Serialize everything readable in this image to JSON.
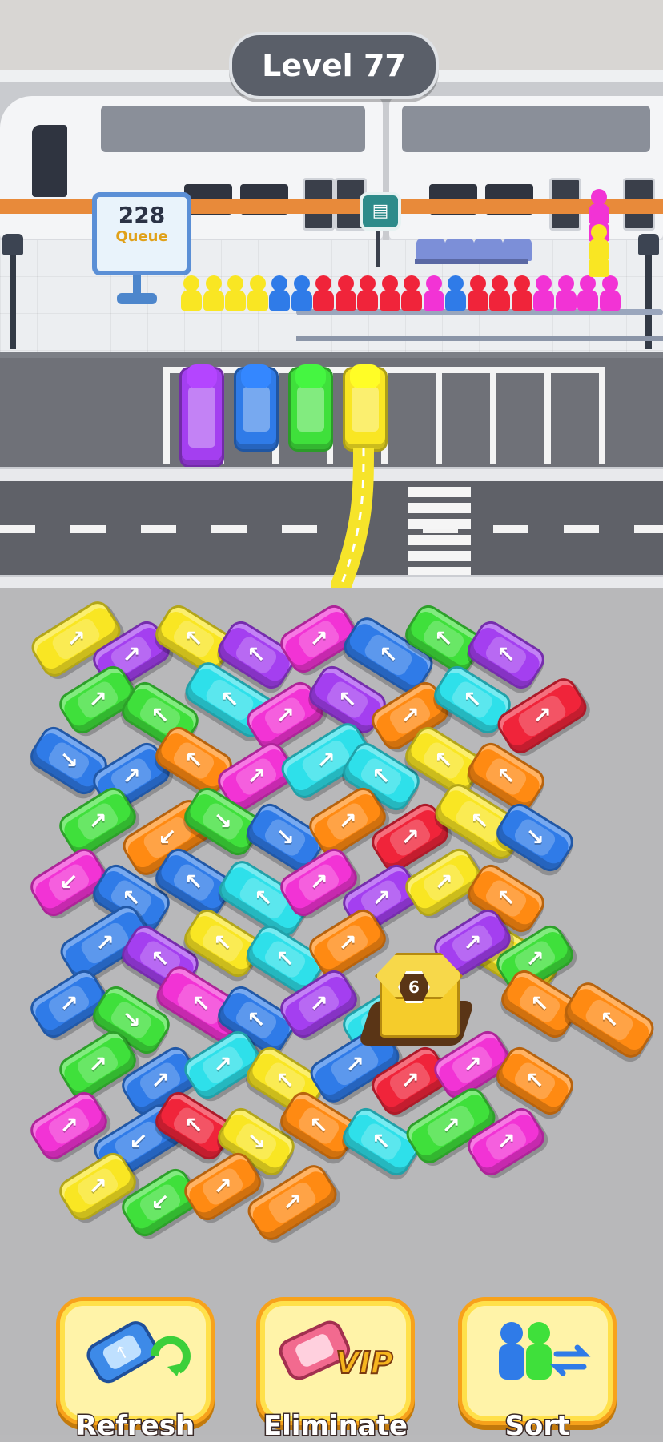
{
  "header": {
    "level_label": "Level 77"
  },
  "queue_board": {
    "count": "228",
    "label": "Queue"
  },
  "station_sign_icon": "bus-stop-icon",
  "colors": {
    "yellow": "#f9e623",
    "blue": "#2f7be8",
    "green": "#3fe03b",
    "purple": "#a43ff0",
    "red": "#f0243a",
    "magenta": "#f233d5",
    "cyan": "#2ee0ea",
    "orange": "#ff8a12",
    "button_border": "#f7a21b"
  },
  "queue_people": [
    "yellow",
    "yellow",
    "yellow",
    "yellow",
    "blue",
    "blue",
    "red",
    "red",
    "red",
    "red",
    "red",
    "magenta",
    "blue",
    "red",
    "red",
    "red",
    "magenta",
    "magenta",
    "magenta",
    "magenta",
    "magenta",
    "magenta",
    "yellow",
    "yellow"
  ],
  "parked_cars": [
    "purple",
    "blue",
    "green",
    "yellow"
  ],
  "parking_slots_total": 8,
  "shop": {
    "count": "6"
  },
  "buttons": {
    "refresh": {
      "label": "Refresh",
      "icon": "refresh-car-icon"
    },
    "eliminate": {
      "label": "Eliminate",
      "icon": "vip-car-icon",
      "badge": "VIP"
    },
    "sort": {
      "label": "Sort",
      "icon": "sort-people-icon"
    }
  },
  "lot_cars": [
    {
      "c": "yellow",
      "dir": "up-right"
    },
    {
      "c": "purple",
      "dir": "up-right"
    },
    {
      "c": "yellow",
      "dir": "up-left"
    },
    {
      "c": "purple",
      "dir": "up-left"
    },
    {
      "c": "magenta",
      "dir": "up-right"
    },
    {
      "c": "blue",
      "dir": "up-left"
    },
    {
      "c": "green",
      "dir": "up-left"
    },
    {
      "c": "purple",
      "dir": "up-left"
    },
    {
      "c": "green",
      "dir": "up-right"
    },
    {
      "c": "green",
      "dir": "up-left"
    },
    {
      "c": "cyan",
      "dir": "up-left"
    },
    {
      "c": "magenta",
      "dir": "up-right"
    },
    {
      "c": "purple",
      "dir": "up-left"
    },
    {
      "c": "orange",
      "dir": "up-right"
    },
    {
      "c": "cyan",
      "dir": "up-left"
    },
    {
      "c": "red",
      "dir": "up-right"
    },
    {
      "c": "blue",
      "dir": "down-right"
    },
    {
      "c": "blue",
      "dir": "up-right"
    },
    {
      "c": "orange",
      "dir": "up-left"
    },
    {
      "c": "magenta",
      "dir": "up-right"
    },
    {
      "c": "cyan",
      "dir": "up-right"
    },
    {
      "c": "cyan",
      "dir": "up-left"
    },
    {
      "c": "yellow",
      "dir": "up-left"
    },
    {
      "c": "orange",
      "dir": "up-left"
    },
    {
      "c": "green",
      "dir": "up-right"
    },
    {
      "c": "orange",
      "dir": "down-left"
    },
    {
      "c": "green",
      "dir": "down-right"
    },
    {
      "c": "blue",
      "dir": "down-right"
    },
    {
      "c": "orange",
      "dir": "up-right"
    },
    {
      "c": "red",
      "dir": "up-right"
    },
    {
      "c": "yellow",
      "dir": "up-left"
    },
    {
      "c": "blue",
      "dir": "down-right"
    },
    {
      "c": "magenta",
      "dir": "down-left"
    },
    {
      "c": "blue",
      "dir": "up-left"
    },
    {
      "c": "blue",
      "dir": "up-left"
    },
    {
      "c": "cyan",
      "dir": "up-left"
    },
    {
      "c": "magenta",
      "dir": "up-right"
    },
    {
      "c": "purple",
      "dir": "up-right"
    },
    {
      "c": "yellow",
      "dir": "up-right"
    },
    {
      "c": "orange",
      "dir": "up-left"
    },
    {
      "c": "blue",
      "dir": "up-right"
    },
    {
      "c": "purple",
      "dir": "up-left"
    },
    {
      "c": "yellow",
      "dir": "up-left"
    },
    {
      "c": "cyan",
      "dir": "up-left"
    },
    {
      "c": "orange",
      "dir": "up-right"
    },
    {
      "c": "yellow",
      "dir": "down-right"
    },
    {
      "c": "purple",
      "dir": "up-right"
    },
    {
      "c": "green",
      "dir": "up-right"
    },
    {
      "c": "blue",
      "dir": "up-right"
    },
    {
      "c": "green",
      "dir": "down-right"
    },
    {
      "c": "magenta",
      "dir": "up-left"
    },
    {
      "c": "blue",
      "dir": "up-left"
    },
    {
      "c": "purple",
      "dir": "up-right"
    },
    {
      "c": "cyan",
      "dir": "up-right"
    },
    {
      "c": "orange",
      "dir": "up-left"
    },
    {
      "c": "orange",
      "dir": "up-left"
    },
    {
      "c": "green",
      "dir": "up-right"
    },
    {
      "c": "blue",
      "dir": "up-right"
    },
    {
      "c": "cyan",
      "dir": "up-right"
    },
    {
      "c": "yellow",
      "dir": "up-left"
    },
    {
      "c": "blue",
      "dir": "up-right"
    },
    {
      "c": "red",
      "dir": "up-right"
    },
    {
      "c": "magenta",
      "dir": "up-right"
    },
    {
      "c": "orange",
      "dir": "up-left"
    },
    {
      "c": "magenta",
      "dir": "up-right"
    },
    {
      "c": "blue",
      "dir": "down-left"
    },
    {
      "c": "red",
      "dir": "up-left"
    },
    {
      "c": "yellow",
      "dir": "down-right"
    },
    {
      "c": "orange",
      "dir": "up-left"
    },
    {
      "c": "cyan",
      "dir": "up-left"
    },
    {
      "c": "green",
      "dir": "up-right"
    },
    {
      "c": "magenta",
      "dir": "up-right"
    },
    {
      "c": "yellow",
      "dir": "up-right"
    },
    {
      "c": "green",
      "dir": "down-left"
    },
    {
      "c": "orange",
      "dir": "up-right"
    },
    {
      "c": "orange",
      "dir": "up-right"
    }
  ]
}
